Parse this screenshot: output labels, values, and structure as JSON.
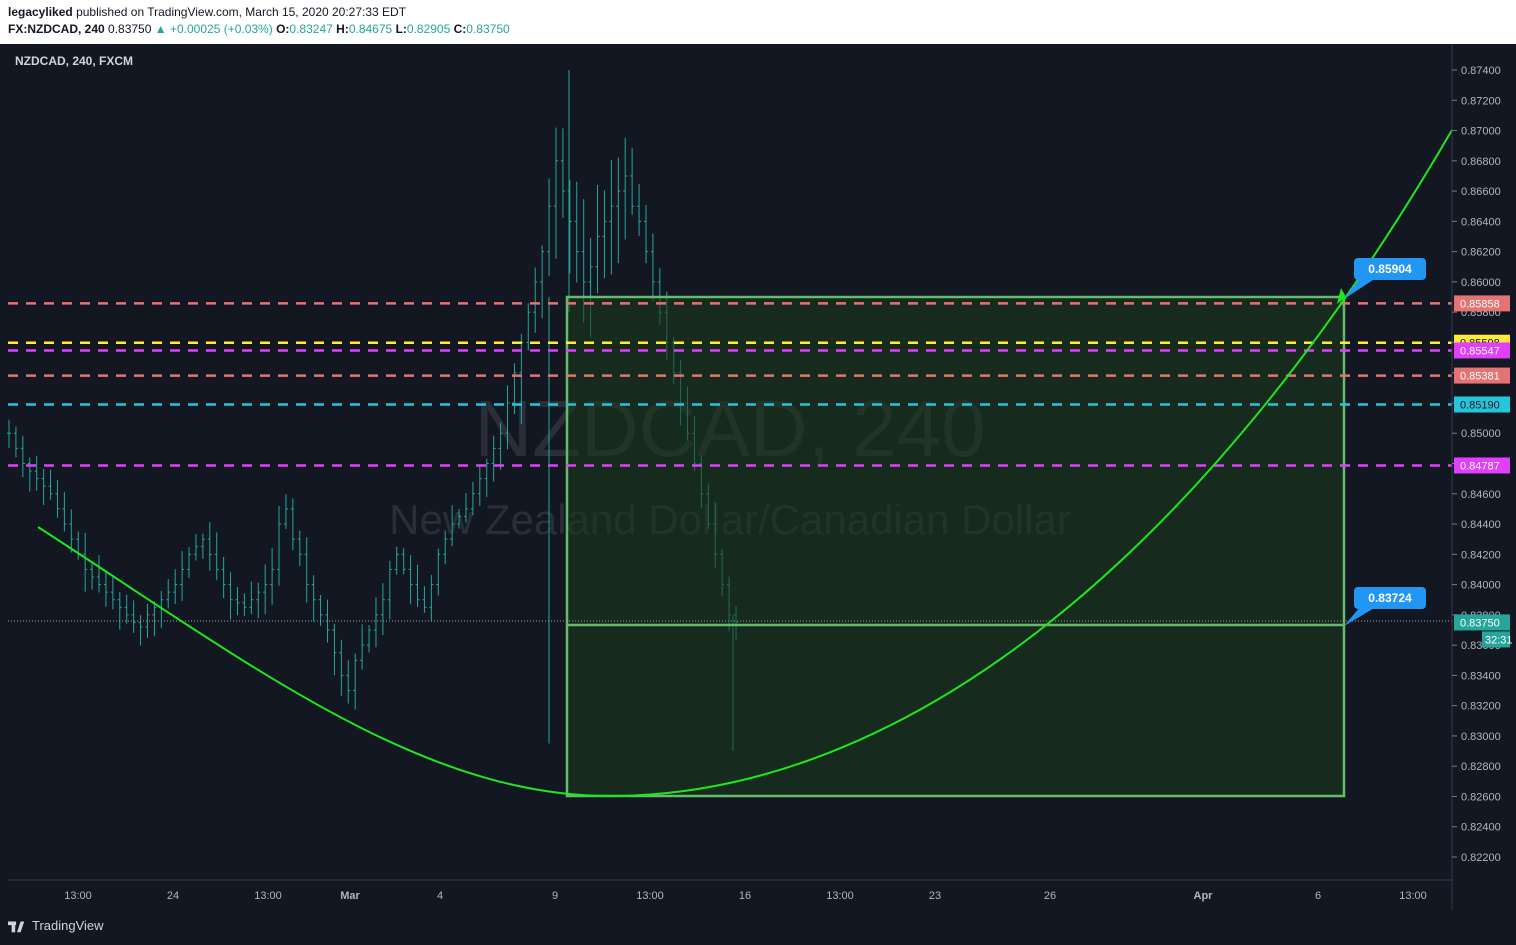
{
  "header": {
    "author": "legacyliked",
    "published": "published on TradingView.com, March 15, 2020 20:27:33 EDT",
    "symbol": "FX:NZDCAD, 240",
    "last": "0.83750",
    "change": "▲ +0.00025 (+0.03%)",
    "o_label": "O:",
    "o_value": "0.83247",
    "h_label": "H:",
    "h_value": "0.84675",
    "l_label": "L:",
    "l_value": "0.82905",
    "c_label": "C:",
    "c_value": "0.83750"
  },
  "chart": {
    "legend": "NZDCAD, 240, FXCM",
    "watermark_symbol": "NZDCAD, 240",
    "watermark_name": "New Zealand Dollar/Canadian Dollar",
    "background": "#131722",
    "y_ticks": [
      "0.87400",
      "0.87200",
      "0.87000",
      "0.86800",
      "0.86600",
      "0.86400",
      "0.86200",
      "0.86000",
      "0.85800",
      "0.85600",
      "0.85400",
      "0.85200",
      "0.85000",
      "0.84800",
      "0.84600",
      "0.84400",
      "0.84200",
      "0.84000",
      "0.83800",
      "0.83600",
      "0.83400",
      "0.83200",
      "0.83000",
      "0.82800",
      "0.82600",
      "0.82400",
      "0.82200"
    ],
    "x_ticks": [
      "13:00",
      "24",
      "13:00",
      "Mar",
      "4",
      "9",
      "13:00",
      "16",
      "13:00",
      "23",
      "26",
      "Apr",
      "6",
      "13:00"
    ],
    "current_price": "0.83750",
    "countdown": "32:31",
    "horizontal_levels": [
      {
        "price": "0.85858",
        "color": "#e57373"
      },
      {
        "price": "0.85598",
        "color": "#ffeb3b"
      },
      {
        "price": "0.85547",
        "color": "#e040fb"
      },
      {
        "price": "0.85381",
        "color": "#e57373"
      },
      {
        "price": "0.85190",
        "color": "#26c6da"
      },
      {
        "price": "0.84787",
        "color": "#e040fb"
      }
    ],
    "callouts": [
      {
        "label": "0.85904",
        "color": "#2196f3"
      },
      {
        "label": "0.83724",
        "color": "#2196f3"
      }
    ],
    "drawing_color": "#4caf50",
    "curve_color": "#1ee61e",
    "bar_color": "#26a69a"
  },
  "chart_data": {
    "type": "ohlc",
    "symbol": "NZDCAD",
    "timeframe": "240",
    "ylim": [
      0.821,
      0.875
    ],
    "price_scale": "linear",
    "approx_closes_4h": [
      0.85,
      0.849,
      0.848,
      0.8475,
      0.847,
      0.8465,
      0.846,
      0.845,
      0.844,
      0.843,
      0.842,
      0.841,
      0.8405,
      0.84,
      0.8395,
      0.839,
      0.8385,
      0.838,
      0.8375,
      0.8372,
      0.838,
      0.8385,
      0.839,
      0.8395,
      0.84,
      0.841,
      0.842,
      0.8425,
      0.843,
      0.842,
      0.841,
      0.84,
      0.839,
      0.8388,
      0.8385,
      0.839,
      0.8395,
      0.84,
      0.841,
      0.844,
      0.845,
      0.843,
      0.842,
      0.84,
      0.839,
      0.838,
      0.837,
      0.8355,
      0.834,
      0.833,
      0.835,
      0.836,
      0.837,
      0.838,
      0.839,
      0.841,
      0.842,
      0.841,
      0.84,
      0.839,
      0.8385,
      0.84,
      0.842,
      0.843,
      0.844,
      0.8445,
      0.845,
      0.846,
      0.847,
      0.848,
      0.849,
      0.85,
      0.852,
      0.854,
      0.856,
      0.858,
      0.86,
      0.862,
      0.865,
      0.868,
      0.866,
      0.864,
      0.862,
      0.86,
      0.861,
      0.863,
      0.864,
      0.865,
      0.866,
      0.867,
      0.865,
      0.864,
      0.862,
      0.86,
      0.858,
      0.856,
      0.854,
      0.852,
      0.85,
      0.848,
      0.846,
      0.844,
      0.842,
      0.84,
      0.838,
      0.8375
    ]
  }
}
